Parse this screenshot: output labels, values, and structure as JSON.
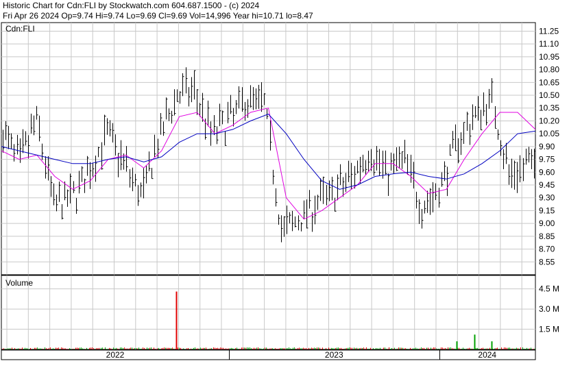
{
  "header": {
    "title": "Historic Chart for Cdn:FLI by Stockwatch.com 604.687.1500 - (c) 2024",
    "summary": "Fri Apr 26 2024   Op=9.74  Hi=9.74  Lo=9.69  Cl=9.69  Vol=14,996  Year hi=10.71  lo=8.47"
  },
  "colors": {
    "price_bars": "#000000",
    "ma_short": "#e000e0",
    "ma_long": "#0000c0",
    "volume_up": "#00a000",
    "volume_down": "#e00000",
    "grid": "#c8c8c8"
  },
  "chart_data": [
    {
      "type": "ohlc",
      "title": "Cdn:FLI",
      "y_axis_side": "right",
      "ylim": [
        8.4,
        11.35
      ],
      "y_ticks": [
        "11.25",
        "11.10",
        "10.95",
        "10.80",
        "10.65",
        "10.50",
        "10.35",
        "10.20",
        "10.05",
        "9.90",
        "9.75",
        "9.60",
        "9.45",
        "9.30",
        "9.15",
        "9.00",
        "8.85",
        "8.70",
        "8.55"
      ],
      "x_labels": [
        "2022",
        "2023",
        "2024"
      ],
      "grid": true,
      "points": [
        {
          "x": "2021-12",
          "y": 10.1
        },
        {
          "x": "2022-01",
          "y": 9.7
        },
        {
          "x": "2022-02",
          "y": 10.2
        },
        {
          "x": "2022-03",
          "y": 9.2
        },
        {
          "x": "2022-04",
          "y": 9.3
        },
        {
          "x": "2022-05",
          "y": 9.6
        },
        {
          "x": "2022-06",
          "y": 10.05
        },
        {
          "x": "2022-07",
          "y": 9.7
        },
        {
          "x": "2022-08",
          "y": 9.3
        },
        {
          "x": "2022-09",
          "y": 10.0
        },
        {
          "x": "2022-10",
          "y": 10.5
        },
        {
          "x": "2022-11",
          "y": 10.55
        },
        {
          "x": "2022-12",
          "y": 10.05
        },
        {
          "x": "2023-01",
          "y": 10.2
        },
        {
          "x": "2023-02",
          "y": 10.45
        },
        {
          "x": "2023-03",
          "y": 10.4
        },
        {
          "x": "2023-04",
          "y": 8.9
        },
        {
          "x": "2023-05",
          "y": 9.05
        },
        {
          "x": "2023-06",
          "y": 9.25
        },
        {
          "x": "2023-07",
          "y": 9.35
        },
        {
          "x": "2023-08",
          "y": 9.55
        },
        {
          "x": "2023-09",
          "y": 9.85
        },
        {
          "x": "2023-10",
          "y": 9.6
        },
        {
          "x": "2023-11",
          "y": 9.75
        },
        {
          "x": "2023-12",
          "y": 9.2
        },
        {
          "x": "2024-01",
          "y": 9.4
        },
        {
          "x": "2024-02",
          "y": 9.95
        },
        {
          "x": "2024-03",
          "y": 10.25
        },
        {
          "x": "2024-04",
          "y": 10.45
        },
        {
          "x": "2024-05",
          "y": 9.55
        },
        {
          "x": "2024-06",
          "y": 9.69
        }
      ],
      "series": [
        {
          "values": [
            9.85,
            9.75,
            9.8,
            9.55,
            9.4,
            9.5,
            9.75,
            9.8,
            9.65,
            9.85,
            10.25,
            10.3,
            10.05,
            10.15,
            10.3,
            10.35,
            9.3,
            9.05,
            9.15,
            9.3,
            9.45,
            9.7,
            9.7,
            9.55,
            9.35,
            9.4,
            9.75,
            10.05,
            10.3,
            10.3,
            10.1
          ]
        },
        {
          "values": [
            9.9,
            9.85,
            9.8,
            9.75,
            9.7,
            9.7,
            9.75,
            9.78,
            9.72,
            9.78,
            9.95,
            10.05,
            10.05,
            10.1,
            10.2,
            10.28,
            10.05,
            9.75,
            9.5,
            9.4,
            9.45,
            9.55,
            9.58,
            9.6,
            9.55,
            9.52,
            9.58,
            9.7,
            9.85,
            10.05,
            10.08
          ]
        }
      ]
    },
    {
      "type": "bar",
      "title": "Volume",
      "y_ticks": [
        "4.5 M",
        "3.0 M",
        "1.5 M"
      ],
      "ylim": [
        0,
        5.5
      ],
      "y_unit": "M",
      "peak_volume": 4.3,
      "notable": [
        {
          "x": "2022-10",
          "value": 4.3,
          "direction": "down"
        },
        {
          "x": "2024-02",
          "value": 0.6,
          "direction": "up"
        },
        {
          "x": "2024-03",
          "value": 1.1,
          "direction": "up"
        },
        {
          "x": "2024-04",
          "value": 0.6,
          "direction": "up"
        }
      ]
    }
  ]
}
